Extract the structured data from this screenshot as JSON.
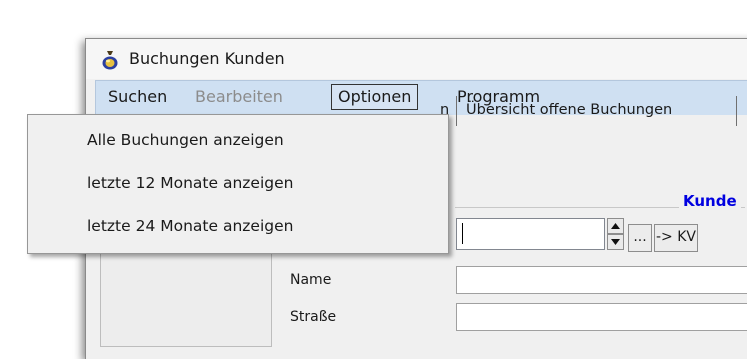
{
  "window": {
    "title": "Buchungen Kunden"
  },
  "menubar": {
    "items": [
      {
        "label": "Suchen",
        "state": "normal"
      },
      {
        "label": "Bearbeiten",
        "state": "disabled"
      },
      {
        "label": "Optionen",
        "state": "active"
      },
      {
        "label": "Programm",
        "state": "normal"
      }
    ]
  },
  "dropdown": {
    "items": [
      {
        "label": "Alle Buchungen anzeigen"
      },
      {
        "label": "letzte 12 Monate anzeigen"
      },
      {
        "label": "letzte 24 Monate anzeigen"
      }
    ]
  },
  "tabs": {
    "partial_label": "n",
    "overview_label": "Übersicht offene Buchungen"
  },
  "kunde": {
    "legend": "Kunde",
    "value": "",
    "browse_label": "...",
    "kv_label": "-> KV"
  },
  "fields": {
    "name_label": "Name",
    "street_label": "Straße"
  },
  "colors": {
    "accent_text": "#0000e0",
    "menubar_bg": "#cfe0f2",
    "window_bg": "#f0f0f0"
  }
}
